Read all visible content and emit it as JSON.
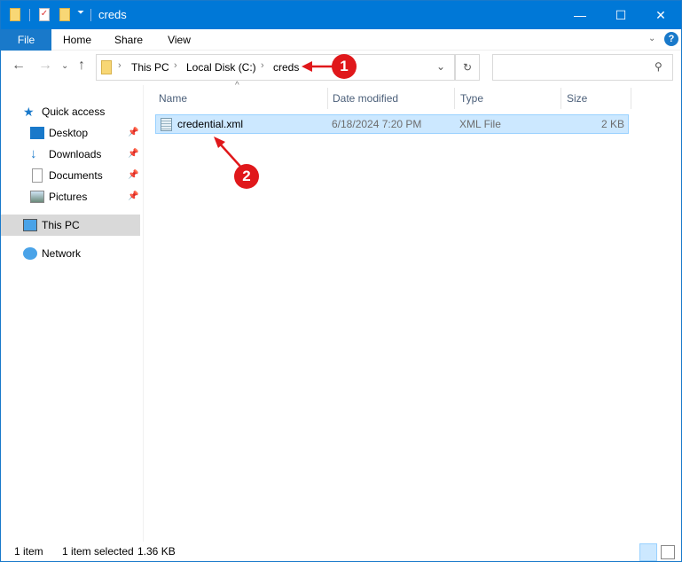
{
  "window": {
    "title": "creds",
    "minimize": "—",
    "maximize": "☐",
    "close": "✕"
  },
  "ribbon": {
    "tabs": [
      "File",
      "Home",
      "Share",
      "View"
    ],
    "help": "?"
  },
  "address": {
    "crumbs": [
      "This PC",
      "Local Disk (C:)",
      "creds"
    ]
  },
  "search": {
    "placeholder": ""
  },
  "sidebar": {
    "items": [
      {
        "label": "Quick access",
        "icon": "star-icon"
      },
      {
        "label": "Desktop",
        "icon": "desktop-icon",
        "pinned": true
      },
      {
        "label": "Downloads",
        "icon": "download-icon",
        "pinned": true
      },
      {
        "label": "Documents",
        "icon": "documents-icon",
        "pinned": true
      },
      {
        "label": "Pictures",
        "icon": "pictures-icon",
        "pinned": true
      },
      {
        "label": "This PC",
        "icon": "computer-icon",
        "selected": true
      },
      {
        "label": "Network",
        "icon": "network-icon"
      }
    ]
  },
  "columns": [
    "Name",
    "Date modified",
    "Type",
    "Size"
  ],
  "files": [
    {
      "name": "credential.xml",
      "date": "6/18/2024 7:20 PM",
      "type": "XML File",
      "size": "2 KB",
      "selected": true
    }
  ],
  "status": {
    "count": "1 item",
    "selected": "1 item selected",
    "size": "1.36 KB"
  },
  "annotations": [
    "1",
    "2"
  ],
  "colors": {
    "accent": "#0078d7",
    "selection": "#cce8ff",
    "annotation": "#e0181b"
  }
}
